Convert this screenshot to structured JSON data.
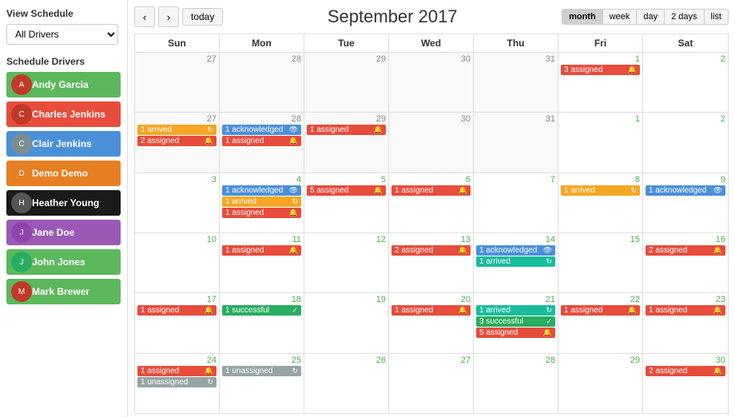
{
  "sidebar": {
    "view_schedule_label": "View Schedule",
    "driver_select": {
      "value": "All Drivers",
      "options": [
        "All Drivers"
      ]
    },
    "schedule_drivers_label": "Schedule Drivers",
    "drivers": [
      {
        "id": "andy-garcia",
        "name": "Andy Garcia",
        "bg": "#5cb85c",
        "avatar_bg": "#c0392b"
      },
      {
        "id": "charles-jenkins",
        "name": "Charles Jenkins",
        "bg": "#e74c3c",
        "avatar_bg": "#c0392b"
      },
      {
        "id": "clair-jenkins",
        "name": "Clair Jenkins",
        "bg": "#4a90d9",
        "avatar_bg": "#7f8c8d"
      },
      {
        "id": "demo-demo",
        "name": "Demo Demo",
        "bg": "#e67e22",
        "avatar_bg": "#e67e22"
      },
      {
        "id": "heather-young",
        "name": "Heather Young",
        "bg": "#1a1a1a",
        "avatar_bg": "#555"
      },
      {
        "id": "jane-doe",
        "name": "Jane Doe",
        "bg": "#9b59b6",
        "avatar_bg": "#8e44ad"
      },
      {
        "id": "john-jones",
        "name": "John Jones",
        "bg": "#5cb85c",
        "avatar_bg": "#27ae60"
      },
      {
        "id": "mark-brewer",
        "name": "Mark Brewer",
        "bg": "#5cb85c",
        "avatar_bg": "#c0392b"
      }
    ]
  },
  "calendar": {
    "title": "September 2017",
    "nav": {
      "prev": "‹",
      "next": "›",
      "today": "today"
    },
    "view_buttons": [
      "month",
      "week",
      "day",
      "2 days",
      "list"
    ],
    "active_view": "month",
    "day_names": [
      "Sun",
      "Mon",
      "Tue",
      "Wed",
      "Thu",
      "Fri",
      "Sat"
    ],
    "weeks": [
      {
        "days": [
          {
            "num": "27",
            "other": true,
            "events": []
          },
          {
            "num": "28",
            "other": true,
            "events": []
          },
          {
            "num": "29",
            "other": true,
            "events": []
          },
          {
            "num": "30",
            "other": true,
            "events": []
          },
          {
            "num": "31",
            "other": true,
            "events": []
          },
          {
            "num": "1",
            "events": [
              {
                "label": "3 assigned",
                "color": "ev-red",
                "icon": "🔔"
              }
            ]
          },
          {
            "num": "2",
            "events": []
          }
        ]
      },
      {
        "days": [
          {
            "num": "27",
            "other": true,
            "events": [
              {
                "label": "1 arrived",
                "color": "ev-orange",
                "icon": "⏻"
              },
              {
                "label": "2 assigned",
                "color": "ev-red",
                "icon": "🔔"
              }
            ]
          },
          {
            "num": "28",
            "other": true,
            "events": [
              {
                "label": "1 acknowledged",
                "color": "ev-blue",
                "icon": "👁"
              },
              {
                "label": "1 assigned",
                "color": "ev-red",
                "icon": "🔔"
              }
            ]
          },
          {
            "num": "29",
            "other": true,
            "events": [
              {
                "label": "1 assigned",
                "color": "ev-red",
                "icon": "🔔"
              }
            ]
          },
          {
            "num": "30",
            "other": true,
            "events": []
          },
          {
            "num": "31",
            "other": true,
            "events": []
          },
          {
            "num": "1",
            "events": []
          },
          {
            "num": "2",
            "events": []
          }
        ]
      },
      {
        "days": [
          {
            "num": "3",
            "events": []
          },
          {
            "num": "4",
            "events": [
              {
                "label": "1 acknowledged",
                "color": "ev-blue",
                "icon": "👁"
              },
              {
                "label": "1 arrived",
                "color": "ev-orange",
                "icon": "⏻"
              },
              {
                "label": "1 assigned",
                "color": "ev-red",
                "icon": "🔔"
              }
            ]
          },
          {
            "num": "5",
            "events": [
              {
                "label": "5 assigned",
                "color": "ev-red",
                "icon": "🔔"
              }
            ]
          },
          {
            "num": "6",
            "events": [
              {
                "label": "1 assigned",
                "color": "ev-red",
                "icon": "🔔"
              }
            ]
          },
          {
            "num": "7",
            "events": []
          },
          {
            "num": "8",
            "events": [
              {
                "label": "1 arrived",
                "color": "ev-orange",
                "icon": "⏻"
              }
            ]
          },
          {
            "num": "9",
            "events": [
              {
                "label": "1 acknowledged",
                "color": "ev-blue",
                "icon": "👁"
              }
            ]
          }
        ]
      },
      {
        "days": [
          {
            "num": "10",
            "events": []
          },
          {
            "num": "11",
            "events": [
              {
                "label": "1 assigned",
                "color": "ev-red",
                "icon": "🔔"
              }
            ]
          },
          {
            "num": "12",
            "events": []
          },
          {
            "num": "13",
            "events": [
              {
                "label": "2 assigned",
                "color": "ev-red",
                "icon": "🔔"
              }
            ]
          },
          {
            "num": "14",
            "events": [
              {
                "label": "1 acknowledged",
                "color": "ev-blue",
                "icon": "👁"
              },
              {
                "label": "1 arrived",
                "color": "ev-teal",
                "icon": "⏻"
              }
            ]
          },
          {
            "num": "15",
            "events": []
          },
          {
            "num": "16",
            "events": [
              {
                "label": "2 assigned",
                "color": "ev-red",
                "icon": "🔔"
              }
            ]
          }
        ]
      },
      {
        "days": [
          {
            "num": "17",
            "events": [
              {
                "label": "1 assigned",
                "color": "ev-red",
                "icon": "🔔"
              }
            ]
          },
          {
            "num": "18",
            "events": [
              {
                "label": "1 successful",
                "color": "ev-green",
                "icon": "✓"
              }
            ]
          },
          {
            "num": "19",
            "events": []
          },
          {
            "num": "20",
            "events": [
              {
                "label": "1 assigned",
                "color": "ev-red",
                "icon": "🔔"
              }
            ]
          },
          {
            "num": "21",
            "events": [
              {
                "label": "1 arrived",
                "color": "ev-teal",
                "icon": "⏻"
              },
              {
                "label": "3 successful",
                "color": "ev-green",
                "icon": "✓"
              },
              {
                "label": "5 assigned",
                "color": "ev-red",
                "icon": "🔔"
              }
            ]
          },
          {
            "num": "22",
            "events": [
              {
                "label": "1 assigned",
                "color": "ev-red",
                "icon": "🔔"
              }
            ]
          },
          {
            "num": "23",
            "events": [
              {
                "label": "1 assigned",
                "color": "ev-red",
                "icon": "🔔"
              }
            ]
          }
        ]
      },
      {
        "days": [
          {
            "num": "24",
            "events": [
              {
                "label": "1 assigned",
                "color": "ev-red",
                "icon": "🔔"
              },
              {
                "label": "1 unassigned",
                "color": "ev-gray",
                "icon": "⏻"
              }
            ]
          },
          {
            "num": "25",
            "events": [
              {
                "label": "1 unassigned",
                "color": "ev-gray",
                "icon": "⏻"
              }
            ]
          },
          {
            "num": "26",
            "events": []
          },
          {
            "num": "27",
            "events": []
          },
          {
            "num": "28",
            "events": []
          },
          {
            "num": "29",
            "events": []
          },
          {
            "num": "30",
            "events": [
              {
                "label": "2 assigned",
                "color": "ev-red",
                "icon": "🔔"
              }
            ]
          }
        ]
      }
    ]
  }
}
